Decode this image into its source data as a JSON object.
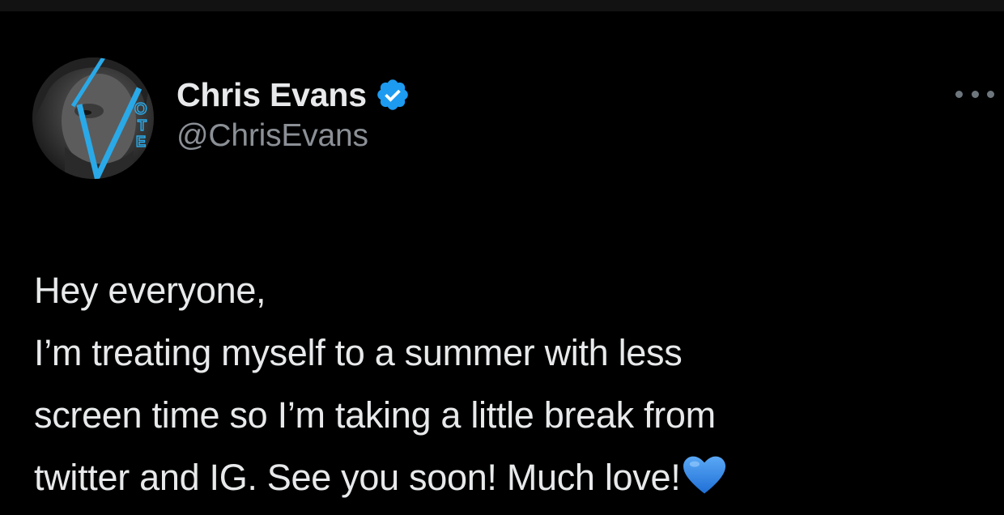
{
  "author": {
    "display_name": "Chris Evans",
    "handle": "@ChrisEvans",
    "verified_icon": "verified-badge-icon",
    "avatar_label": "VOTE"
  },
  "menu": {
    "icon": "more-options-icon"
  },
  "tweet": {
    "lines": [
      "Hey everyone,",
      "I’m treating myself to a summer with less",
      "screen time so I’m taking a little break from",
      "twitter and IG. See you soon! Much love!"
    ],
    "emoji": "blue-heart-icon"
  },
  "colors": {
    "background": "#000000",
    "primary_text": "#e7e9ea",
    "secondary_text": "#8b9096",
    "verified_blue": "#1d9bf0",
    "heart_blue": "#3a8fe8"
  }
}
